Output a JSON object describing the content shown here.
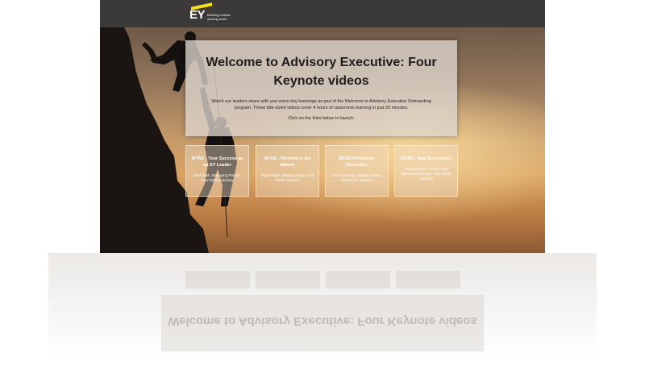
{
  "header": {
    "logo_text": "EY",
    "logo_tagline": "Building a better working world"
  },
  "intro": {
    "title": "Welcome to Advisory Executive: Four Keynote videos",
    "description": "Watch our leaders share with you some key learnings as part of the Welcome to Advisory Executive Onboarding program. These bite-sized videos cover 4 hours of classroom learning in just 20 minutes.",
    "cta": "Click on the links below to launch:"
  },
  "videos": [
    {
      "title": "WTAE - Your Success as an EY Leader",
      "speaker": "Paul Clark, Managing Partner, Asia Pacific Advisory"
    },
    {
      "title": "WTAE - Winning in the Market",
      "speaker": "Nigel Knight, Deputy Leader, Asia Pacific Advisory"
    },
    {
      "title": "WTAE Relentless Execution",
      "speaker": "Sue Cummings, Quality Leader, Asia Pacific Advisory"
    },
    {
      "title": "WTAE - Deal Economics",
      "speaker": "Alya Karlyana, Finance and Operations Director, Asia Pacific Advisory"
    }
  ],
  "colors": {
    "topbar": "#3b3a38",
    "brand_yellow": "#ffe600"
  }
}
